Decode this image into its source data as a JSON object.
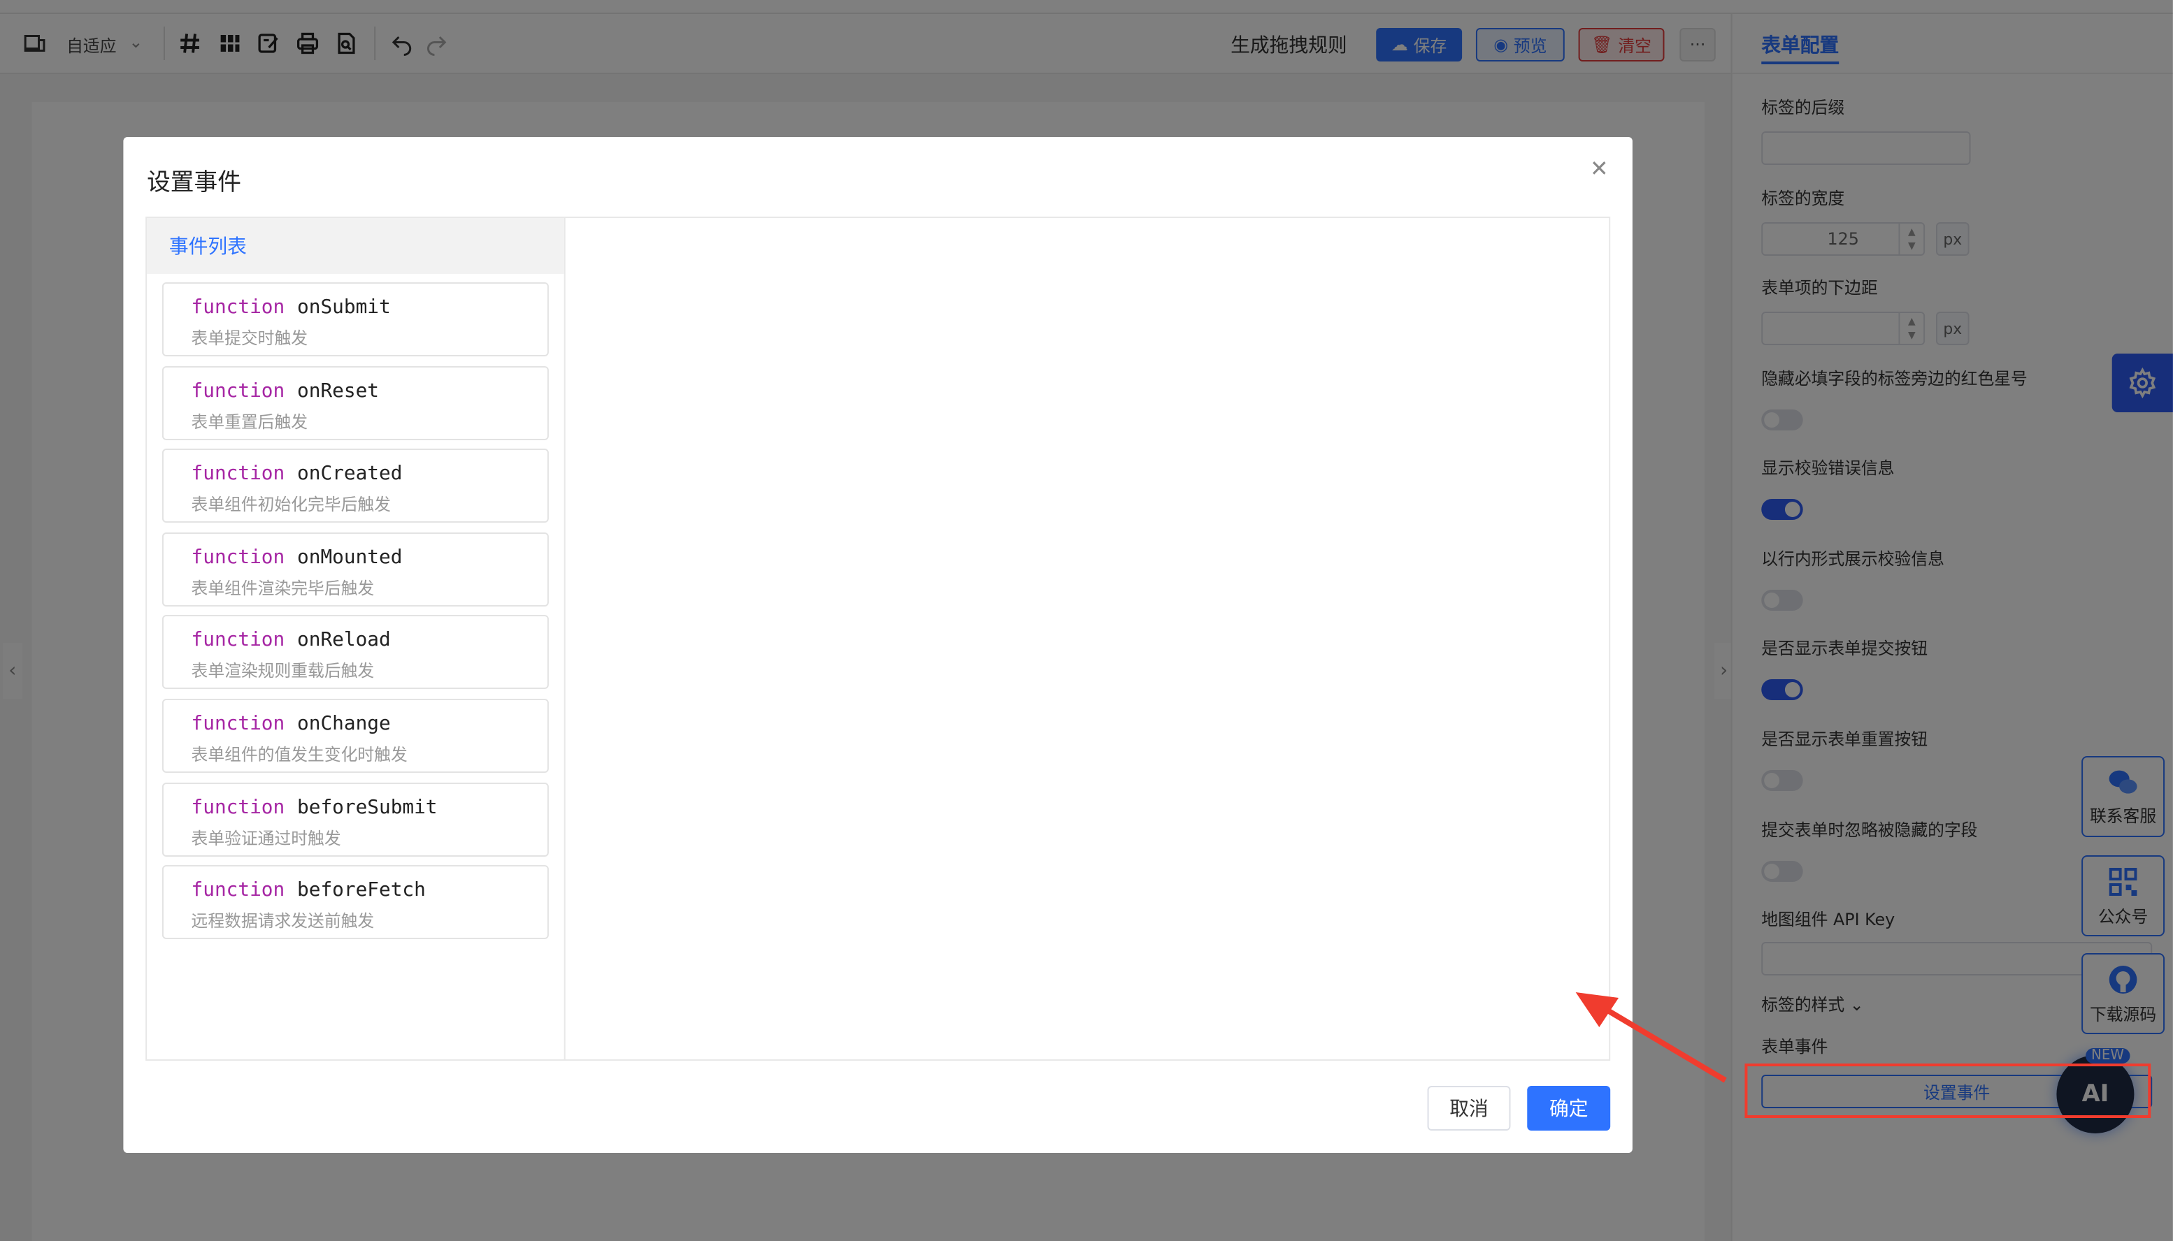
{
  "toolbar": {
    "adapt_label": "自适应",
    "rule_label": "生成拖拽规则",
    "save_label": "保存",
    "preview_label": "预览",
    "clear_label": "清空",
    "more_label": "···"
  },
  "right_panel": {
    "tab_label": "表单配置",
    "label_suffix": "标签的后缀",
    "label_width": "标签的宽度",
    "label_width_value": "125",
    "label_width_unit": "px",
    "item_margin": "表单项的下边距",
    "item_margin_unit": "px",
    "hide_required_asterisk": "隐藏必填字段的标签旁边的红色星号",
    "show_validate_msg": "显示校验错误信息",
    "inline_validate_msg": "以行内形式展示校验信息",
    "show_submit_btn": "是否显示表单提交按钮",
    "show_reset_btn": "是否显示表单重置按钮",
    "ignore_hidden": "提交表单时忽略被隐藏的字段",
    "map_api_key": "地图组件 API Key",
    "label_style": "标签的样式",
    "form_events": "表单事件",
    "set_event_button": "设置事件",
    "toggles": [
      false,
      true,
      false,
      true,
      false,
      false
    ]
  },
  "float_cards": {
    "service": "联系客服",
    "official": "公众号",
    "download": "下载源码",
    "ai": "AI",
    "ai_new": "NEW"
  },
  "modal": {
    "title": "设置事件",
    "list_header": "事件列表",
    "keyword": "function",
    "events": [
      {
        "name": "onSubmit",
        "desc": "表单提交时触发"
      },
      {
        "name": "onReset",
        "desc": "表单重置后触发"
      },
      {
        "name": "onCreated",
        "desc": "表单组件初始化完毕后触发"
      },
      {
        "name": "onMounted",
        "desc": "表单组件渲染完毕后触发"
      },
      {
        "name": "onReload",
        "desc": "表单渲染规则重载后触发"
      },
      {
        "name": "onChange",
        "desc": "表单组件的值发生变化时触发"
      },
      {
        "name": "beforeSubmit",
        "desc": "表单验证通过时触发"
      },
      {
        "name": "beforeFetch",
        "desc": "远程数据请求发送前触发"
      }
    ],
    "cancel_label": "取消",
    "ok_label": "确定"
  },
  "colors": {
    "primary": "#2e73ff",
    "danger": "#e23c3c",
    "keyword": "#a626a4",
    "annotation": "#f03c2e"
  }
}
